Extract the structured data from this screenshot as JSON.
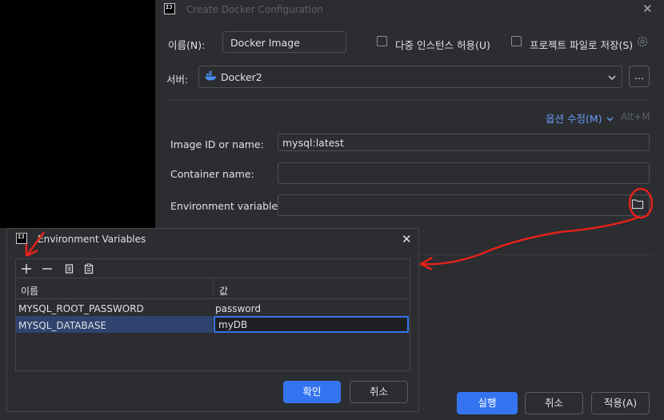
{
  "main_dialog": {
    "title": "Create Docker Configuration",
    "name_label": "이름(N):",
    "name_value": "Docker Image",
    "allow_multiple_label": "다중 인스턴스 허용(U)",
    "store_as_project_file_label": "프로젝트 파일로 저장(S)",
    "server_label": "서버:",
    "server_value": "Docker2",
    "more_button": "...",
    "modify_options_label": "옵션 수정(M)",
    "modify_options_shortcut": "Alt+M",
    "image_label": "Image ID or name:",
    "image_value": "mysql:latest",
    "container_label": "Container name:",
    "container_value": "",
    "env_label": "Environment variables:",
    "env_value": "",
    "run_button": "실행",
    "cancel_button": "취소",
    "apply_button": "적용(A)"
  },
  "env_dialog": {
    "title": "Environment Variables",
    "col_name": "이름",
    "col_value": "값",
    "rows": [
      {
        "name": "MYSQL_ROOT_PASSWORD",
        "value": "password"
      },
      {
        "name": "MYSQL_DATABASE",
        "value": "myDB"
      }
    ],
    "ok_button": "확인",
    "cancel_button": "취소"
  },
  "icons": [
    "intellij-logo-icon",
    "close-icon",
    "settings-icon",
    "docker-icon",
    "chevron-down-icon",
    "folder-icon",
    "add-icon",
    "remove-icon",
    "copy-icon",
    "paste-icon"
  ],
  "colors": {
    "accent": "#3574f0",
    "annotation": "#e5211a",
    "link": "#6b9bfa",
    "selection": "#2e436e"
  }
}
